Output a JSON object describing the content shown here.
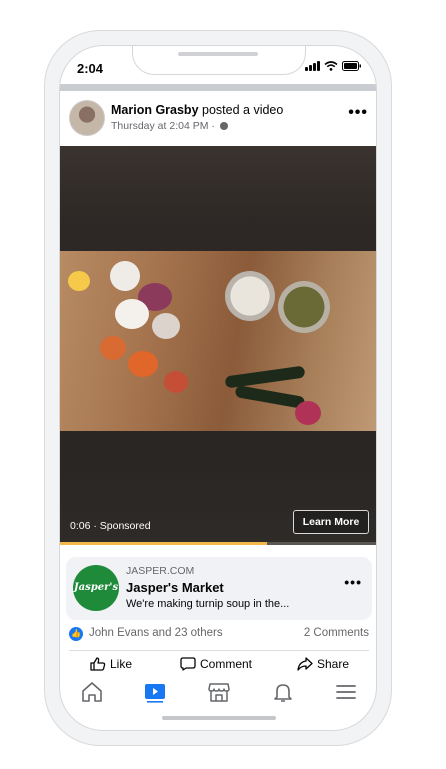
{
  "status_bar": {
    "time": "2:04"
  },
  "post": {
    "author": "Marion Grasby",
    "action": "posted a video",
    "timestamp": "Thursday at 2:04 PM ·",
    "more_icon": "ellipsis-icon"
  },
  "video": {
    "time_sponsored": "0:06 · Sponsored",
    "cta_label": "Learn More",
    "progress": 0.65
  },
  "ad": {
    "logo_text": "Jasper's",
    "domain": "JASPER.COM",
    "title": "Jasper's Market",
    "description": "We're making turnip soup in the..."
  },
  "reactions": {
    "summary": "John Evans and 23 others",
    "comments": "2 Comments"
  },
  "actions": {
    "like": "Like",
    "comment": "Comment",
    "share": "Share"
  },
  "tabbar": {
    "items": [
      "home-icon",
      "video-icon",
      "marketplace-icon",
      "notifications-icon",
      "menu-icon"
    ],
    "active": "video-icon",
    "active_color": "#1877f2"
  }
}
